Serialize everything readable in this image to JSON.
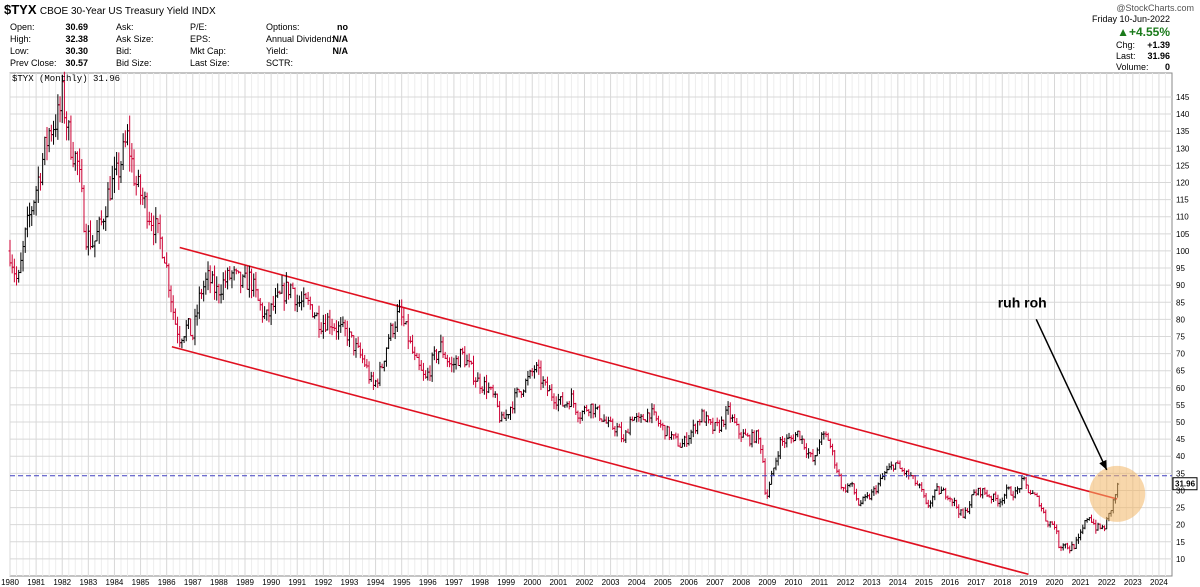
{
  "header": {
    "symbol": "$TYX",
    "name": "CBOE 30-Year US Treasury Yield",
    "exchange": "INDX",
    "watermark": "@StockCharts.com",
    "quote": {
      "open_label": "Open:",
      "open": "30.69",
      "high_label": "High:",
      "high": "32.38",
      "low_label": "Low:",
      "low": "30.30",
      "prevclose_label": "Prev Close:",
      "prevclose": "30.57",
      "ask_label": "Ask:",
      "asksize_label": "Ask Size:",
      "bid_label": "Bid:",
      "bidsize_label": "Bid Size:",
      "pe_label": "P/E:",
      "eps_label": "EPS:",
      "mktcap_label": "Mkt Cap:",
      "lastsize_label": "Last Size:",
      "options_label": "Options:",
      "options": "no",
      "dividend_label": "Annual Dividend:",
      "dividend": "N/A",
      "yield_label": "Yield:",
      "yield": "N/A",
      "sctr_label": "SCTR:"
    },
    "right": {
      "date": "Friday 10-Jun-2022",
      "pct_change": "+4.55%",
      "chg_label": "Chg:",
      "chg": "+1.39",
      "last_label": "Last:",
      "last": "31.96",
      "volume_label": "Volume:",
      "volume": "0"
    }
  },
  "colors": {
    "background": "#ffffff",
    "grid": "#d8d8d8",
    "up_bar": "#000000",
    "down_bar": "#cc0033",
    "channel": "#e01020",
    "reference_line": "#4040c0",
    "highlight": "#f2b766",
    "arrow": "#000000",
    "change_up": "#1a7a1a",
    "last_tag": "#ffffff"
  },
  "chart_data": {
    "type": "ohlc-bar",
    "title": "$TYX (Monthly) 31.96",
    "frequency": "monthly",
    "x_axis": {
      "type": "time",
      "min": 1980.0,
      "max": 2024.5,
      "tick_labels": [
        "1980",
        "1981",
        "1982",
        "1983",
        "1984",
        "1985",
        "1986",
        "1987",
        "1988",
        "1989",
        "1990",
        "1991",
        "1992",
        "1993",
        "1994",
        "1995",
        "1996",
        "1997",
        "1998",
        "1999",
        "2000",
        "2001",
        "2002",
        "2003",
        "2004",
        "2005",
        "2006",
        "2007",
        "2008",
        "2009",
        "2010",
        "2011",
        "2012",
        "2013",
        "2014",
        "2015",
        "2016",
        "2017",
        "2018",
        "2019",
        "2020",
        "2021",
        "2022",
        "2023",
        "2024"
      ]
    },
    "y_axis": {
      "position": "right",
      "min": 5,
      "max": 152,
      "tick_labels": [
        10,
        15,
        20,
        25,
        30,
        35,
        40,
        45,
        50,
        55,
        60,
        65,
        70,
        75,
        80,
        85,
        90,
        95,
        100,
        105,
        110,
        115,
        120,
        125,
        130,
        135,
        140,
        145
      ]
    },
    "grid": true,
    "series": [
      {
        "name": "$TYX (Monthly)",
        "points": [
          [
            1980.0,
            100
          ],
          [
            1980.3,
            90
          ],
          [
            1980.6,
            105
          ],
          [
            1980.9,
            115
          ],
          [
            1981.2,
            125
          ],
          [
            1981.5,
            135
          ],
          [
            1981.9,
            140
          ],
          [
            1982.0,
            145
          ],
          [
            1982.3,
            132
          ],
          [
            1982.6,
            125
          ],
          [
            1982.9,
            105
          ],
          [
            1983.2,
            102
          ],
          [
            1983.5,
            108
          ],
          [
            1983.8,
            118
          ],
          [
            1984.1,
            122
          ],
          [
            1984.5,
            133
          ],
          [
            1984.8,
            120
          ],
          [
            1985.1,
            115
          ],
          [
            1985.5,
            108
          ],
          [
            1985.9,
            100
          ],
          [
            1986.1,
            90
          ],
          [
            1986.3,
            80
          ],
          [
            1986.5,
            75
          ],
          [
            1986.8,
            78
          ],
          [
            1987.0,
            75
          ],
          [
            1987.3,
            88
          ],
          [
            1987.6,
            92
          ],
          [
            1987.9,
            88
          ],
          [
            1988.2,
            91
          ],
          [
            1988.5,
            93
          ],
          [
            1988.9,
            90
          ],
          [
            1989.2,
            92
          ],
          [
            1989.5,
            85
          ],
          [
            1989.8,
            80
          ],
          [
            1990.1,
            84
          ],
          [
            1990.5,
            88
          ],
          [
            1990.8,
            90
          ],
          [
            1991.0,
            85
          ],
          [
            1991.5,
            84
          ],
          [
            1991.9,
            79
          ],
          [
            1992.2,
            80
          ],
          [
            1992.6,
            77
          ],
          [
            1992.9,
            76
          ],
          [
            1993.2,
            72
          ],
          [
            1993.6,
            67
          ],
          [
            1993.9,
            60
          ],
          [
            1994.2,
            65
          ],
          [
            1994.5,
            75
          ],
          [
            1994.9,
            82
          ],
          [
            1995.2,
            76
          ],
          [
            1995.5,
            68
          ],
          [
            1995.9,
            62
          ],
          [
            1996.2,
            68
          ],
          [
            1996.5,
            72
          ],
          [
            1996.9,
            66
          ],
          [
            1997.3,
            70
          ],
          [
            1997.6,
            66
          ],
          [
            1997.9,
            62
          ],
          [
            1998.3,
            60
          ],
          [
            1998.6,
            56
          ],
          [
            1998.8,
            50
          ],
          [
            1999.0,
            52
          ],
          [
            1999.4,
            58
          ],
          [
            1999.9,
            63
          ],
          [
            2000.1,
            66
          ],
          [
            2000.5,
            60
          ],
          [
            2000.9,
            57
          ],
          [
            2001.2,
            55
          ],
          [
            2001.5,
            57
          ],
          [
            2001.8,
            52
          ],
          [
            2002.2,
            55
          ],
          [
            2002.6,
            52
          ],
          [
            2002.9,
            49
          ],
          [
            2003.3,
            48
          ],
          [
            2003.5,
            44
          ],
          [
            2003.8,
            52
          ],
          [
            2004.1,
            50
          ],
          [
            2004.5,
            53
          ],
          [
            2004.9,
            49
          ],
          [
            2005.3,
            46
          ],
          [
            2005.7,
            43
          ],
          [
            2006.0,
            46
          ],
          [
            2006.5,
            52
          ],
          [
            2006.9,
            48
          ],
          [
            2007.2,
            49
          ],
          [
            2007.5,
            53
          ],
          [
            2007.9,
            47
          ],
          [
            2008.3,
            45
          ],
          [
            2008.6,
            46
          ],
          [
            2008.8,
            42
          ],
          [
            2008.95,
            27
          ],
          [
            2009.2,
            35
          ],
          [
            2009.5,
            44
          ],
          [
            2009.9,
            45
          ],
          [
            2010.2,
            47
          ],
          [
            2010.5,
            42
          ],
          [
            2010.8,
            38
          ],
          [
            2011.0,
            45
          ],
          [
            2011.3,
            46
          ],
          [
            2011.6,
            38
          ],
          [
            2011.9,
            30
          ],
          [
            2012.2,
            32
          ],
          [
            2012.5,
            26
          ],
          [
            2012.9,
            28
          ],
          [
            2013.2,
            31
          ],
          [
            2013.5,
            35
          ],
          [
            2013.9,
            38
          ],
          [
            2014.1,
            36
          ],
          [
            2014.5,
            34
          ],
          [
            2014.9,
            30
          ],
          [
            2015.1,
            25
          ],
          [
            2015.5,
            30
          ],
          [
            2015.9,
            29
          ],
          [
            2016.2,
            26
          ],
          [
            2016.5,
            22
          ],
          [
            2016.9,
            29
          ],
          [
            2017.2,
            30
          ],
          [
            2017.6,
            28
          ],
          [
            2017.9,
            27
          ],
          [
            2018.2,
            30
          ],
          [
            2018.5,
            29
          ],
          [
            2018.8,
            33
          ],
          [
            2019.0,
            30
          ],
          [
            2019.4,
            27
          ],
          [
            2019.7,
            21
          ],
          [
            2020.0,
            20
          ],
          [
            2020.2,
            13
          ],
          [
            2020.3,
            15
          ],
          [
            2020.6,
            13
          ],
          [
            2020.9,
            15
          ],
          [
            2021.1,
            19
          ],
          [
            2021.3,
            23
          ],
          [
            2021.6,
            19
          ],
          [
            2021.9,
            19
          ],
          [
            2022.1,
            23
          ],
          [
            2022.3,
            28
          ],
          [
            2022.45,
            32
          ]
        ]
      }
    ],
    "annotations": {
      "channel_upper": [
        [
          1986.5,
          101
        ],
        [
          2022.4,
          27.5
        ]
      ],
      "channel_lower": [
        [
          1986.2,
          72
        ],
        [
          2019.0,
          5.5
        ]
      ],
      "reference_level": 34.3,
      "arrow_text": "ruh roh",
      "arrow_from": [
        2019.3,
        80
      ],
      "arrow_to": [
        2022.0,
        36
      ],
      "highlight_center": [
        2022.4,
        29
      ],
      "last_value_tag": "31.96"
    }
  }
}
